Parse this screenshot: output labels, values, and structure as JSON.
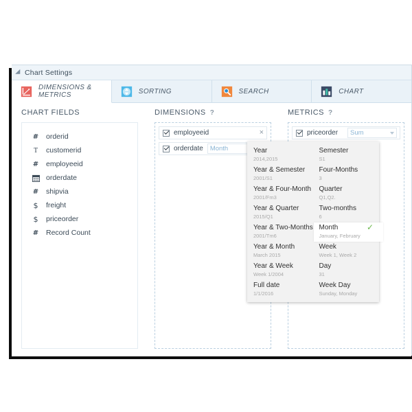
{
  "window": {
    "title": "Chart Settings",
    "collapse_icon": "collapse-triangle-icon"
  },
  "tabs": [
    {
      "label": "DIMENSIONS & METRICS",
      "icon": "axes-chart-icon",
      "active": true
    },
    {
      "label": "SORTING",
      "icon": "sort-updown-icon",
      "active": false
    },
    {
      "label": "SEARCH",
      "icon": "magnifier-icon",
      "active": false
    },
    {
      "label": "CHART",
      "icon": "bar-chart-icon",
      "active": false
    }
  ],
  "chart_fields": {
    "heading": "CHART FIELDS",
    "items": [
      {
        "label": "orderid",
        "type_icon": "number-icon",
        "glyph": "#"
      },
      {
        "label": "customerid",
        "type_icon": "text-icon",
        "glyph": "T"
      },
      {
        "label": "employeeid",
        "type_icon": "number-icon",
        "glyph": "#"
      },
      {
        "label": "orderdate",
        "type_icon": "calendar-icon",
        "glyph": "cal"
      },
      {
        "label": "shipvia",
        "type_icon": "number-icon",
        "glyph": "#"
      },
      {
        "label": "freight",
        "type_icon": "currency-icon",
        "glyph": "$"
      },
      {
        "label": "priceorder",
        "type_icon": "currency-icon",
        "glyph": "$"
      },
      {
        "label": "Record Count",
        "type_icon": "number-icon",
        "glyph": "#"
      }
    ]
  },
  "dimensions": {
    "heading": "DIMENSIONS",
    "help": "?",
    "items": [
      {
        "label": "employeeid",
        "checked": true,
        "select": null,
        "remove": "×"
      },
      {
        "label": "orderdate",
        "checked": true,
        "select": "Month",
        "remove": "×"
      }
    ]
  },
  "metrics": {
    "heading": "METRICS",
    "help": "?",
    "items": [
      {
        "label": "priceorder",
        "checked": true,
        "select": "Sum"
      }
    ]
  },
  "date_dropdown": {
    "left_column": [
      {
        "title": "Year",
        "sample": "2014,2015",
        "selected": false
      },
      {
        "title": "Year & Semester",
        "sample": "2001/S1",
        "selected": false
      },
      {
        "title": "Year & Four-Month",
        "sample": "2001/Fm3",
        "selected": false
      },
      {
        "title": "Year & Quarter",
        "sample": "2015/Q1",
        "selected": false
      },
      {
        "title": "Year & Two-Months",
        "sample": "2001/Tm6",
        "selected": false
      },
      {
        "title": "Year & Month",
        "sample": "March 2015",
        "selected": false
      },
      {
        "title": "Year & Week",
        "sample": "Week 1/2004",
        "selected": false
      },
      {
        "title": "Full date",
        "sample": "1/1/2016",
        "selected": false
      }
    ],
    "right_column": [
      {
        "title": "Semester",
        "sample": "S1",
        "selected": false
      },
      {
        "title": "Four-Months",
        "sample": "3",
        "selected": false
      },
      {
        "title": "Quarter",
        "sample": "Q1,Q2.",
        "selected": false
      },
      {
        "title": "Two-months",
        "sample": "6",
        "selected": false
      },
      {
        "title": "Month",
        "sample": "January, February",
        "selected": true,
        "check": "✓"
      },
      {
        "title": "Week",
        "sample": "Week 1, Week 2",
        "selected": false
      },
      {
        "title": "Day",
        "sample": "31",
        "selected": false
      },
      {
        "title": "Week Day",
        "sample": "Sunday, Monday",
        "selected": false
      }
    ]
  },
  "colors": {
    "header_bg": "#eef4f9",
    "tab_bg": "#eaf2f8",
    "accent_red": "#e8534f",
    "accent_blue": "#4ab4e8",
    "accent_orange": "#f0873d",
    "accent_darkblue": "#3b4a66",
    "check_green": "#6ab84b",
    "dropdown_bg": "#f2f2f2"
  }
}
